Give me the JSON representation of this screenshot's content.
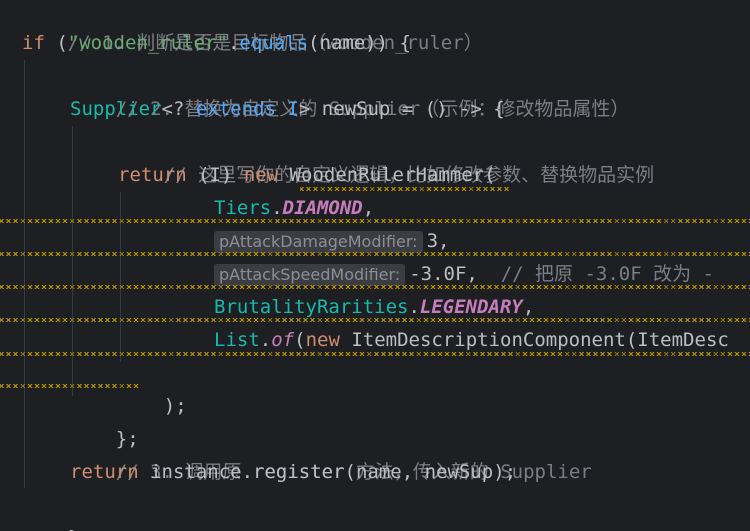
{
  "code": {
    "l1_comment": "// 1. 判断是否是目标物品（wooden_ruler）",
    "l2_if": "if",
    "l2_open": " (",
    "l2_string": "\"wooden_ruler\"",
    "l2_dot": ".",
    "l2_equals": "equals",
    "l2_args": "(name)) {",
    "l3_comment": "// 2. 替换为自定义的 Supplier（示例：修改物品属性）",
    "l4_type": "Supplier",
    "l4_generic": "<? ",
    "l4_extends": "extends",
    "l4_tparam": " I",
    "l4_rest1": "> ",
    "l4_var": "newSup",
    "l4_rest2": " = () -> {",
    "l5_comment": "// 这里写你的自定义逻辑，比如修改参数、替换物品实例",
    "l6_return": "return",
    "l6_cast": " (I) ",
    "l6_new": "new",
    "l6_class": " WoodenRulerHammer(",
    "l7_tiers": "Tiers",
    "l7_dot": ".",
    "l7_diamond": "DIAMOND",
    "l7_comma": ",",
    "l8_hint": "pAttackDamageModifier:",
    "l8_value": "3,",
    "l9_hint": "pAttackSpeedModifier:",
    "l9_value": "-3.0F,",
    "l9_comment": "  // 把原 -3.0F 改为 -",
    "l10_class": "BrutalityRarities",
    "l10_dot": ".",
    "l10_field": "LEGENDARY",
    "l10_comma": ",",
    "l11_list": "List",
    "l11_dot": ".",
    "l11_of": "of",
    "l11_open": "(",
    "l11_new": "new",
    "l11_rest": " ItemDescriptionComponent(ItemDesc",
    "l12_close": ");",
    "l13_close": "};",
    "l14_comment": "// 3. 调用原 register 方法，传入新的 Supplier",
    "l15_return": "return",
    "l15_rest": " instance.register(name, newSup);",
    "l16_close": "}"
  }
}
